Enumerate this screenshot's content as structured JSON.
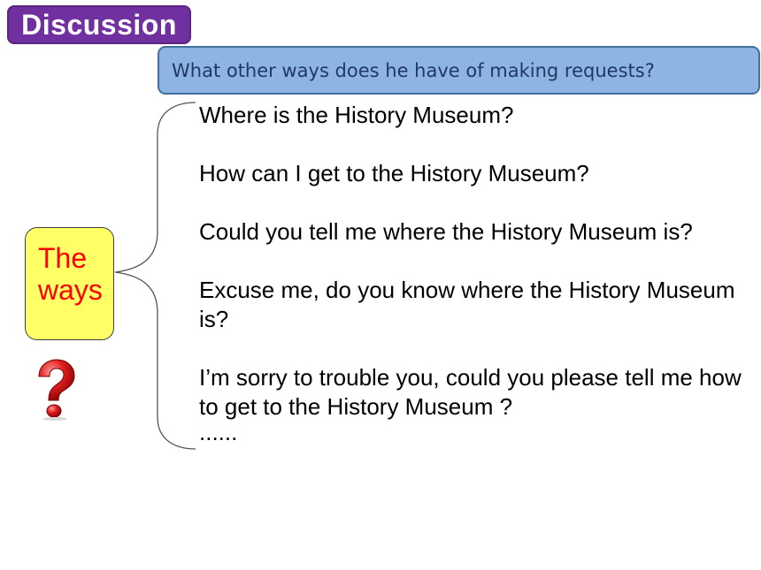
{
  "header": {
    "badge_label": "Discussion",
    "question": "What other ways does he have of making requests?"
  },
  "topic": {
    "line1": "The",
    "line2": "ways"
  },
  "items": [
    "Where is the History Museum?",
    "How can I get to the History Museum?",
    "Could you tell me where the History Museum is?",
    "Excuse me, do you know where the History Museum is?",
    "I’m sorry to trouble you, could you please tell me how to get to the History Museum ?"
  ],
  "ellipsis": "......",
  "icons": {
    "question_mark": "question-mark-icon"
  },
  "colors": {
    "badge_bg": "#7030a0",
    "question_bg": "#8eb4e3",
    "question_text": "#1f3864",
    "topic_bg": "#ffff66",
    "topic_text": "#ff0000",
    "question_mark": "#e02020"
  }
}
